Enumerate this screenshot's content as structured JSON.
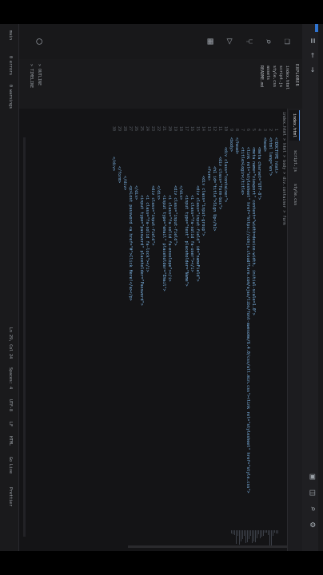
{
  "window": {
    "title_icons": [
      "menu-icon",
      "back-icon",
      "forward-icon",
      "layout-icon",
      "split-icon",
      "search-icon",
      "settings-icon"
    ]
  },
  "activity_bar": [
    "explorer-icon",
    "search-icon",
    "source-control-icon",
    "run-icon",
    "extensions-icon"
  ],
  "sidebar": {
    "header": "EXPLORER",
    "items": [
      "index.html",
      "script.js",
      "style.css",
      "assets",
      "README.md"
    ],
    "outline_label": "> OUTLINE",
    "timeline_label": "> TIMELINE"
  },
  "editor": {
    "tabs": [
      "index.html",
      "script.js",
      "style.css"
    ],
    "breadcrumb": "index.html > html > body > div.container > form",
    "line_numbers": [
      "1",
      "2",
      "3",
      "4",
      "5",
      "6",
      "7",
      "8",
      "9",
      "10",
      "11",
      "12",
      "13",
      "14",
      "15",
      "16",
      "17",
      "18",
      "19",
      "20",
      "21",
      "22",
      "23",
      "24",
      "25",
      "26",
      "27",
      "28",
      "29",
      "30"
    ],
    "code_lines": [
      "<!DOCTYPE html>",
      "<html lang=\"en\">",
      "<head>",
      "    <meta charset=\"UTF-8\">",
      "    <meta name=\"viewport\" content=\"width=device-width, initial-scale=1.0\">",
      "    <link rel=\"stylesheet\" href=\"https://cdnjs.cloudflare.com/ajax/libs/font-awesome/6.4.0/css/all.min.css\"><link rel=\"stylesheet\" href=\"style.css\">",
      "    <title>Login</title>",
      "</head>",
      "<body>",
      "    <div class=\"container\">",
      "        <div class=\"form-box\">",
      "            <h1 id=\"title\">Sign Up</h1>",
      "            <form>",
      "                <div class=\"input-group\">",
      "                    <div class=\"input-field\" id=\"nameField\">",
      "                        <i class=\"fa-solid fa-user\"></i>",
      "                        <input type=\"text\" placeholder=\"Name\">",
      "                    </div>",
      "                    <div class=\"input-field\">",
      "                        <i class=\"fa-solid fa-envelope\"></i>",
      "                        <input type=\"email\" placeholder=\"Email\">",
      "                    </div>",
      "                    <div class=\"input-field\">",
      "                        <i class=\"fa-solid fa-lock\"></i>",
      "                        <input type=\"password\" placeholder=\"Password\">",
      "                    </div>",
      "                    <p>Lost password <a href=\"#\">Click Here!</a></p>",
      "                </div>",
      "            </form>",
      "        </div>"
    ]
  },
  "status_bar": {
    "left": [
      "main",
      "0 errors",
      "0 warnings"
    ],
    "right": [
      "Ln 29, Col 24",
      "Spaces: 4",
      "UTF-8",
      "LF",
      "HTML",
      "Go Live",
      "Prettier"
    ]
  }
}
